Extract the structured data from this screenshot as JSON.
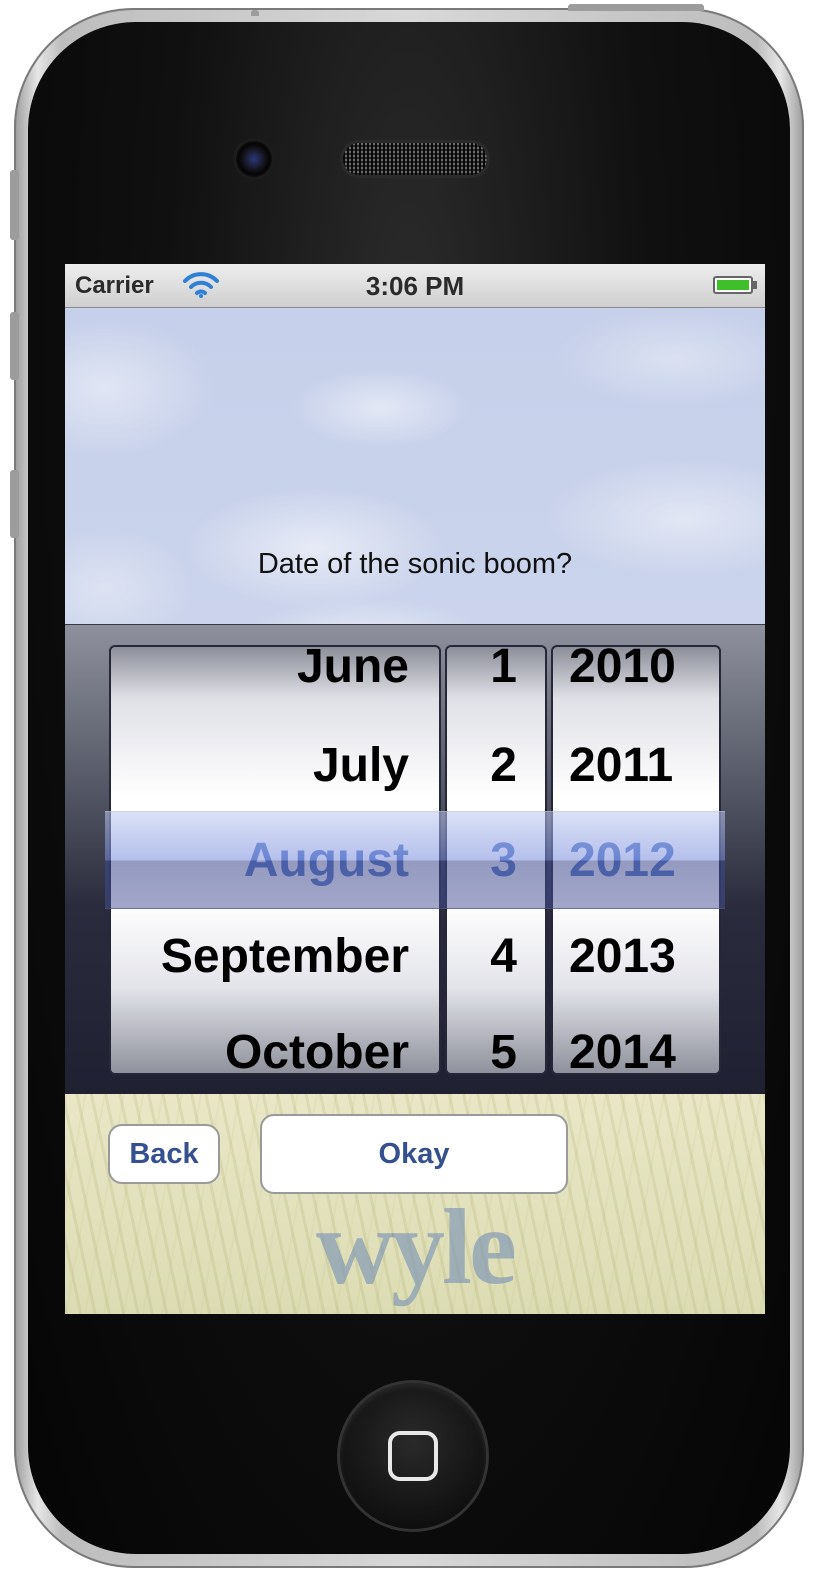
{
  "status_bar": {
    "carrier": "Carrier",
    "time": "3:06 PM",
    "wifi_icon": "wifi-icon",
    "battery_icon": "battery-icon",
    "battery_color": "#3fbf2a"
  },
  "question": "Date of the sonic boom?",
  "picker": {
    "months": [
      "June",
      "July",
      "August",
      "September",
      "October"
    ],
    "days": [
      "1",
      "2",
      "3",
      "4",
      "5"
    ],
    "years": [
      "2010",
      "2011",
      "2012",
      "2013",
      "2014"
    ],
    "selected": {
      "month": "August",
      "day": "3",
      "year": "2012"
    },
    "selection_color": "#5a7cc6"
  },
  "buttons": {
    "back": "Back",
    "okay": "Okay",
    "text_color": "#34508f"
  },
  "logo": "wyle",
  "device": {
    "home_button_icon": "home-button-icon",
    "camera_icon": "front-camera-icon",
    "speaker_icon": "earpiece-speaker-icon"
  }
}
